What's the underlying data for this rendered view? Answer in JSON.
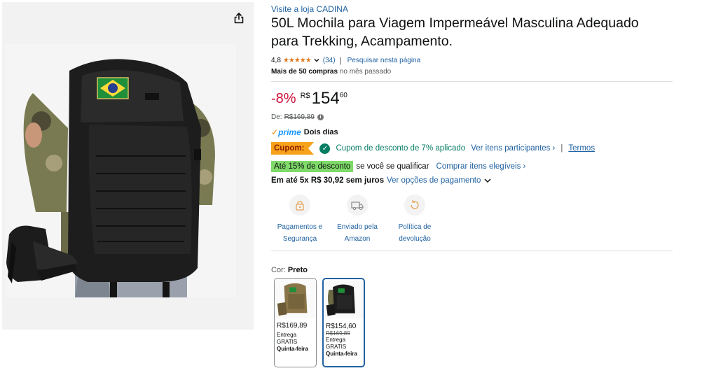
{
  "product": {
    "store_link": "Visite a loja CADINA",
    "title": "50L Mochila para Viagem Impermeável Masculina Adequado para Trekking, Acampamento.",
    "rating_value": "4,8",
    "stars": "★★★★★",
    "rating_count": "(34)",
    "search_page": "Pesquisar nesta página",
    "bought_bold": "Mais de 50 compras",
    "bought_rest": " no mês passado"
  },
  "price": {
    "discount": "-8%",
    "currency": "R$",
    "whole": "154",
    "fraction": "60",
    "list_label": "De:",
    "list_price": "R$169,89"
  },
  "delivery": {
    "prime_check": "✓",
    "prime_word": "prime",
    "prime_days": "Dois dias"
  },
  "coupon": {
    "tag": "Cupom:",
    "text": "Cupom de desconto de 7% aplicado",
    "participants": "Ver itens participantes ›",
    "terms": "Termos",
    "pipe": "|"
  },
  "promo": {
    "badge": "Até 15% de desconto",
    "text": "se você se qualificar",
    "link": "Comprar itens elegíveis ›"
  },
  "installments": {
    "bold": "Em até 5x R$ 30,92 sem juros",
    "link": "Ver opções de pagamento"
  },
  "features": [
    {
      "icon": "lock-icon",
      "line1": "Pagamentos e",
      "line2": "Segurança"
    },
    {
      "icon": "truck-icon",
      "line1": "Enviado pela",
      "line2": "Amazon"
    },
    {
      "icon": "return-icon",
      "line1": "Política de",
      "line2": "devolução"
    }
  ],
  "color": {
    "label": "Cor: ",
    "value": "Preto"
  },
  "swatches": [
    {
      "color": "khaki",
      "price": "R$169,89",
      "strike": "",
      "line1": "Entrega",
      "line2": "GRATIS",
      "line3": "Quinta-feira",
      "selected": false
    },
    {
      "color": "black",
      "price": "R$154,60",
      "strike": "R$169,89",
      "line1": "Entrega",
      "line2": "GRATIS",
      "line3": "Quinta-feira",
      "selected": true
    }
  ],
  "icons": {
    "share": "share-icon",
    "chevron": "chevron-down-icon",
    "info": "info-icon"
  },
  "colors": {
    "link": "#2162a1",
    "discount": "#cc0c39",
    "star": "#de7921",
    "coupon_bg": "#f7a21b",
    "success": "#067d62",
    "promo_bg": "#7fda69",
    "prime": "#1a98ff"
  }
}
